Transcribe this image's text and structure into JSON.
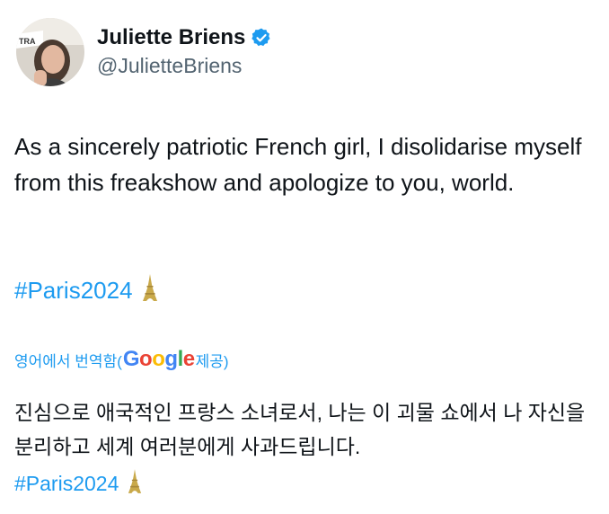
{
  "author": {
    "display_name": "Juliette Briens",
    "handle": "@JulietteBriens",
    "verified": true,
    "avatar_sign_text": "TRA"
  },
  "tweet": {
    "text": "As a sincerely patriotic French girl, I disolidarise myself from this freakshow and apologize to you, world.",
    "hashtag": "#Paris2024",
    "emoji": "eiffel-tower-icon"
  },
  "translation": {
    "label_prefix": "영어에서 번역함(",
    "provider_letters": [
      "G",
      "o",
      "o",
      "g",
      "l",
      "e"
    ],
    "label_suffix": " 제공)",
    "text": "진심으로 애국적인 프랑스 소녀로서, 나는 이 괴물 쇼에서 나 자신을 분리하고 세계 여러분에게 사과드립니다.",
    "hashtag": "#Paris2024"
  },
  "colors": {
    "link": "#1d9bf0",
    "text": "#0f1419",
    "secondary": "#536471",
    "verified": "#1d9bf0",
    "google_blue": "#4285F4",
    "google_red": "#EA4335",
    "google_yellow": "#FBBC05",
    "google_green": "#34A853"
  }
}
